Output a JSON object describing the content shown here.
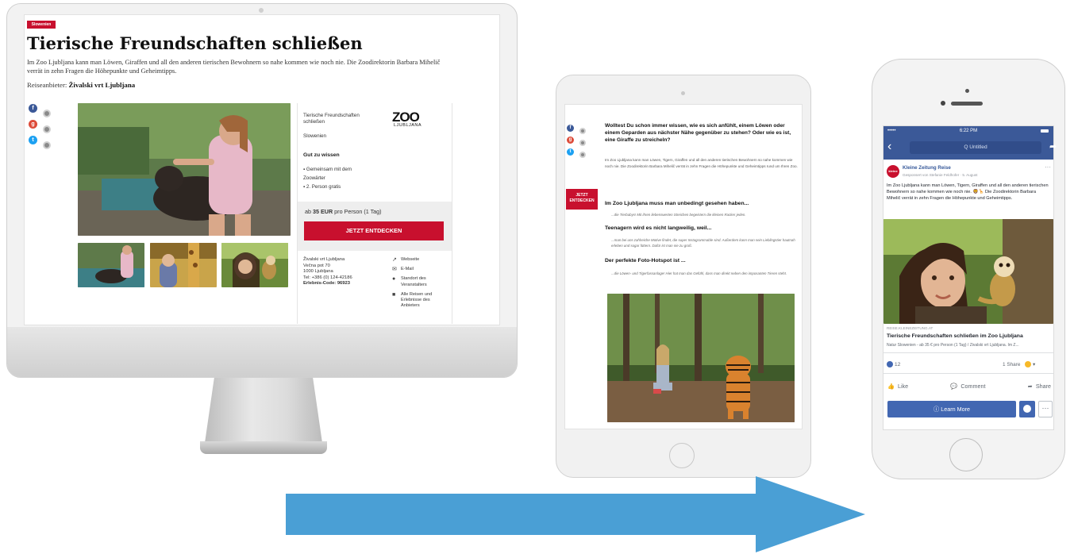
{
  "desktop": {
    "badge": "Slowenien",
    "title": "Tierische Freundschaften schließen",
    "description": "Im Zoo Ljubljana kann man Löwen, Giraffen und all den anderen tierischen Bewohnern so nahe kommen wie noch nie. Die Zoodirektorin Barbara Mihelič verrät in zehn Fragen die Höhepunkte und Geheimtipps.",
    "provider_label": "Reiseanbieter:",
    "provider_name": "Živalski vrt Ljubljana",
    "info": {
      "name": "Tierische Freundschaften schließen",
      "region": "Slowenien",
      "logo_text": "ZOO",
      "logo_sub": "LJUBLJANA",
      "good_to_know_title": "Gut zu wissen",
      "good_to_know": [
        "Gemeinsam mit dem Zoowärter",
        "2. Person gratis"
      ],
      "price_prefix": "ab",
      "price": "35 EUR",
      "price_suffix": "pro Person (1 Tag)",
      "cta": "JETZT ENTDECKEN"
    },
    "contact": {
      "name": "Živalski vrt Ljubljana",
      "street": "Večna pot 70",
      "city": "1000 Ljubljana",
      "phone": "Tel: +386 (0) 124-42186",
      "code_label": "Erlebnis-Code: 96923"
    },
    "links": [
      "Webseite",
      "E-Mail",
      "Standort des Veranstalters",
      "Alle Reisen und Erlebnisse des Anbieters"
    ],
    "share_letters": [
      "f",
      "g",
      "t"
    ]
  },
  "tablet": {
    "cta": "JETZT ENTDECKEN",
    "question": "Wolltest Du schon immer wissen, wie es sich anfühlt, einem Löwen oder einem Geparden aus nächster Nähe gegenüber zu stehen? Oder wie es ist, eine Giraffe zu streicheln?",
    "paragraph": "Im Zoo Ljubljana kann man Löwen, Tigern, Giraffen und all den anderen tierischen Bewohnern so nahe kommen wie noch nie. Die Zoodirektorin Barbara Mihelič verrät in zehn Fragen die Höhepunkte und Geheimtipps rund um Ihren Zoo.",
    "sections": [
      {
        "heading": "Im Zoo Ljubljana muss man unbedingt gesehen haben...",
        "answer": "...die Tierbabys! Mit ihren liebenswerten Streichen begeistern die kleinen Racker jeden."
      },
      {
        "heading": "Teenagern wird es nicht langweilig, weil...",
        "answer": "...man bei uns zahlreiche Motive findet, die super Instagrammable sind. Außerdem kann man sein Lieblingstier hautnah erleben und sogar füttern. Dafür ist man nie zu groß."
      },
      {
        "heading": "Der perfekte Foto-Hotspot ist ...",
        "answer": "...die Löwen- und Tigerfassanlage! Hier hat man das Gefühl, dass man direkt neben den imposanten Tieren steht."
      }
    ]
  },
  "phone": {
    "status_time": "6:22 PM",
    "status_left": "•••••",
    "search_placeholder": "Q Untitled",
    "page_name": "Kleine Zeitung Reise",
    "page_meta": "Gesponsert von Stefanie Feldhofer · 5. August",
    "post_text": "Im Zoo Ljubljana kann man Löwen, Tigern, Giraffen und all den anderen tierischen Bewohnern so nahe kommen wie noch nie. 🦁🦒 Die Zoodirektorin Barbara Mihelič verrät in zehn Fragen die Höhepunkte und Geheimtipps.",
    "link_domain": "REISE.KLEINEZEITUNG.AT",
    "link_title": "Tierische Freundschaften schließen im Zoo Ljubljana",
    "link_sub": "Natur Slowenien - ab 35 € pro Person (1 Tag) / Živalski vrt Ljubljana. Im Z...",
    "reactions": "12",
    "shares": "1 Share",
    "actions": [
      "Like",
      "Comment",
      "Share"
    ],
    "cta": "Learn More",
    "avatar_text": "kleine",
    "brand_color": "#3b5998"
  },
  "colors": {
    "accent_red": "#c8102e",
    "facebook_blue": "#4267b2",
    "arrow_blue": "#4a9fd5"
  }
}
